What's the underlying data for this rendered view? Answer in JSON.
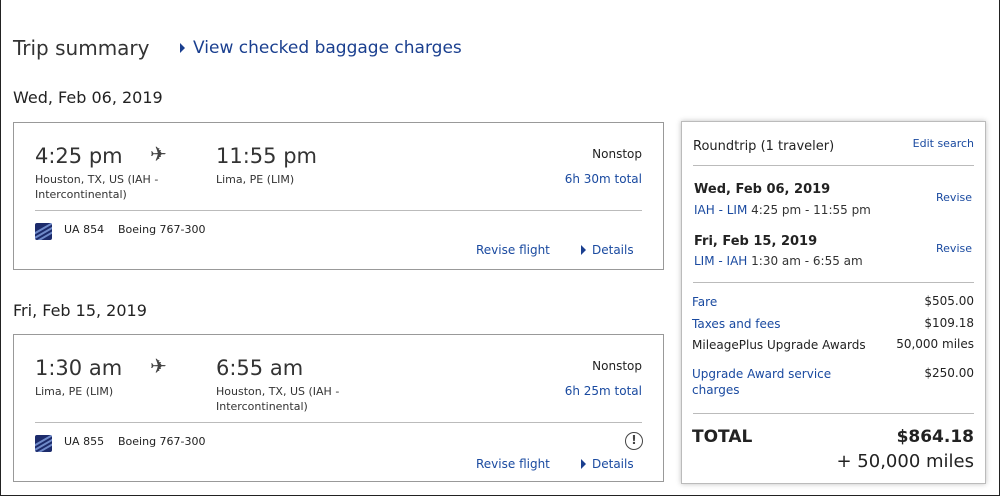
{
  "header": {
    "title": "Trip summary",
    "baggage_link": "View checked baggage charges"
  },
  "outbound": {
    "date": "Wed, Feb 06, 2019",
    "depart_time": "4:25 pm",
    "arrive_time": "11:55 pm",
    "depart_place": "Houston, TX, US (IAH - Intercontinental)",
    "arrive_place": "Lima, PE (LIM)",
    "stops": "Nonstop",
    "duration": "6h 30m total",
    "flight_number": "UA 854",
    "aircraft": "Boeing 767-300",
    "revise_label": "Revise flight",
    "details_label": "Details"
  },
  "return": {
    "date": "Fri, Feb 15, 2019",
    "depart_time": "1:30 am",
    "arrive_time": "6:55 am",
    "depart_place": "Lima, PE (LIM)",
    "arrive_place": "Houston, TX, US (IAH - Intercontinental)",
    "stops": "Nonstop",
    "duration": "6h 25m total",
    "flight_number": "UA 855",
    "aircraft": "Boeing 767-300",
    "info_symbol": "!",
    "revise_label": "Revise flight",
    "details_label": "Details"
  },
  "summary": {
    "title": "Roundtrip (1 traveler)",
    "edit_label": "Edit search",
    "legs": [
      {
        "date": "Wed, Feb 06, 2019",
        "codes": "IAH - LIM",
        "times": "4:25 pm - 11:55 pm",
        "revise": "Revise"
      },
      {
        "date": "Fri, Feb 15, 2019",
        "codes": "LIM - IAH",
        "times": "1:30 am - 6:55 am",
        "revise": "Revise"
      }
    ],
    "fare_label": "Fare",
    "fare_value": "$505.00",
    "taxes_label": "Taxes and fees",
    "taxes_value": "$109.18",
    "awards_label": "MileagePlus Upgrade Awards",
    "awards_value": "50,000 miles",
    "service_label": "Upgrade Award service charges",
    "service_value": "$250.00",
    "total_label": "TOTAL",
    "total_value": "$864.18",
    "total_miles": "+ 50,000 miles"
  },
  "icons": {
    "plane": "airplane-icon",
    "airline_logo": "united-globe-logo",
    "info": "info-circle-icon",
    "triangle": "triangle-right-icon"
  },
  "colors": {
    "link": "#1a4aa0",
    "logo": "#1c2b6b"
  }
}
